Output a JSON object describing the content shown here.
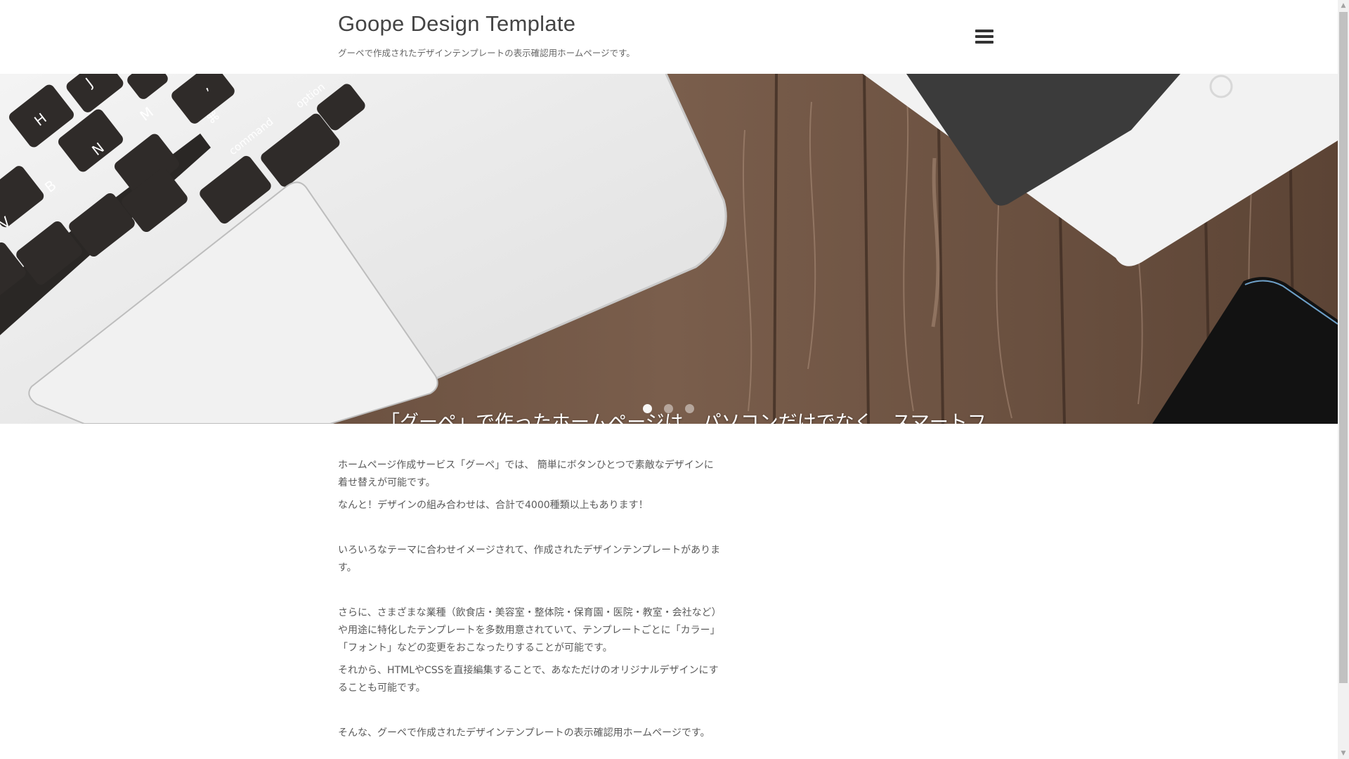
{
  "header": {
    "site_title": "Goope Design Template",
    "site_description": "グーペで作成されたデザインテンプレートの表示確認用ホームページです。",
    "menu_icon": "hamburger-menu-icon"
  },
  "hero": {
    "caption": "「グーペ」で作ったホームページは、パソコンだけでなく、スマートフ",
    "slide_count": 3,
    "active_slide": 1,
    "image_subject": "laptop keyboard, tablet and smartphone on wooden desk",
    "keys": {
      "j": "J",
      "h": "H",
      "m": "M",
      "n": "N",
      "b": "B",
      "v": "V",
      "comma": ",",
      "command_symbol": "⌘",
      "command": "command",
      "option": "option"
    }
  },
  "content": {
    "paragraphs": [
      "ホームページ作成サービス「グーペ」では、 簡単にボタンひとつで素敵なデザインに着せ替えが可能です。",
      "なんと！デザインの組み合わせは、合計で4000種類以上もあります！",
      "いろいろなテーマに合わせイメージされて、作成されたデザインテンプレートがあります。",
      "さらに、さまざまな業種（飲食店・美容室・整体院・保育園・医院・教室・会社など）や用途に特化したテンプレートを多数用意されていて、テンプレートごとに「カラー」「フォント」などの変更をおこなったりすることが可能です。",
      "それから、HTMLやCSSを直接編集することで、あなただけのオリジナルデザインにすることも可能です。",
      "そんな、グーペで作成されたデザインテンプレートの表示確認用ホームページです。"
    ]
  },
  "colors": {
    "wood": "#6e5444",
    "laptop": "#ebebeb",
    "key": "#2f2b29",
    "text": "#5a5a5a"
  }
}
